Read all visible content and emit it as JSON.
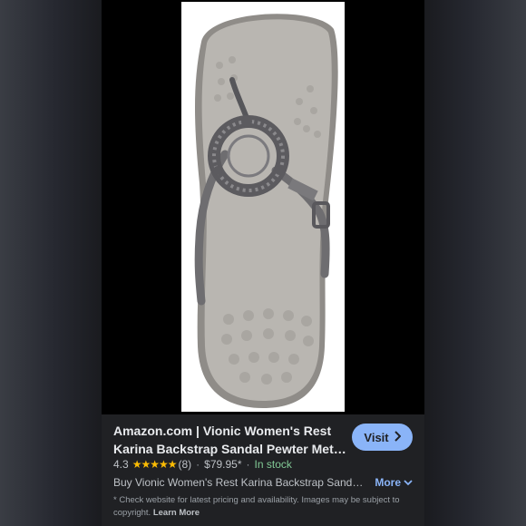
{
  "result": {
    "title_line1": "Amazon.com | Vionic Women's Rest",
    "title_line2": "Karina Backstrap Sandal Pewter Metal...",
    "visit_label": "Visit",
    "rating": "4.3",
    "stars": "★★★★★",
    "review_count": "(8)",
    "price": "$79.95*",
    "stock": "In stock",
    "description": "Buy Vionic Women's Rest Karina Backstrap Sandal...",
    "more_label": "More",
    "disclaimer": "* Check website for latest pricing and availability. Images may be subject to copyright.",
    "learn_more": "Learn More"
  },
  "icons": {
    "visit": "chevron-right-icon",
    "more": "chevron-down-icon"
  },
  "colors": {
    "accent": "#8ab4f8",
    "stars": "#fbbc04",
    "in_stock": "#81c995",
    "panel": "#202124"
  }
}
